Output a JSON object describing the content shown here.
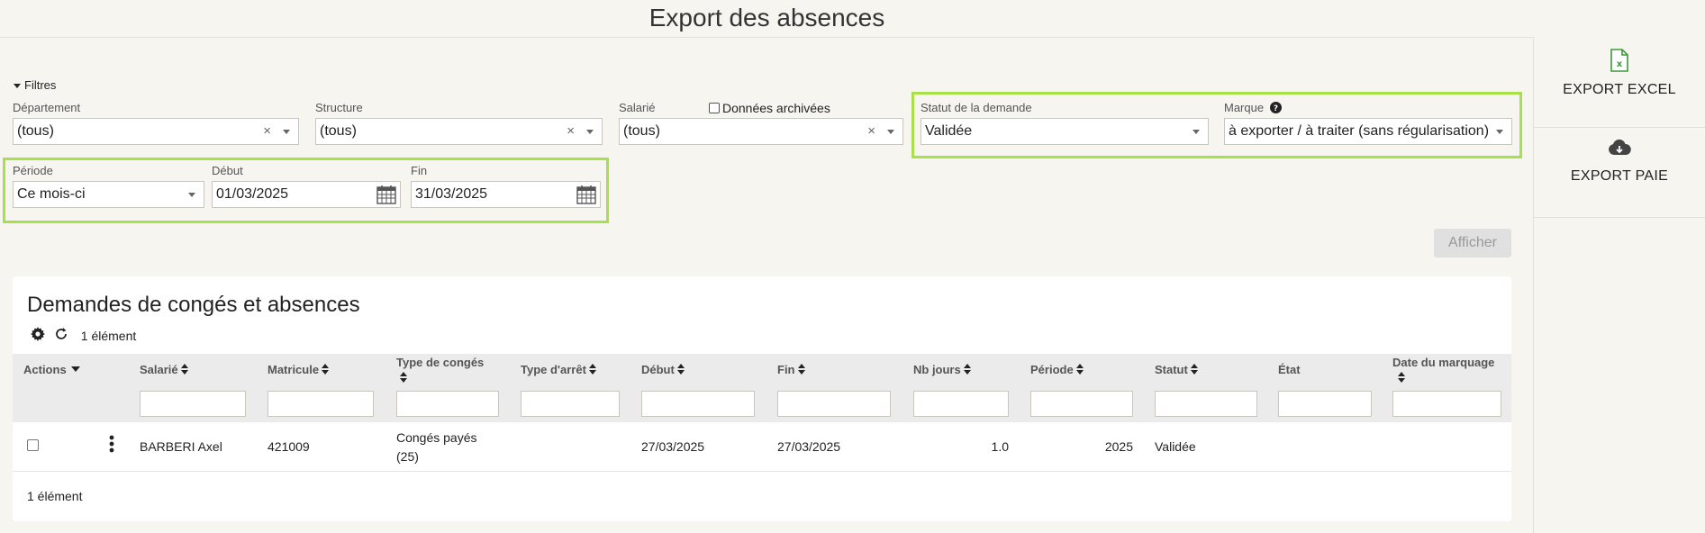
{
  "page": {
    "title": "Export des absences"
  },
  "exports": [
    {
      "label": "EXPORT EXCEL",
      "icon": "excel-file-icon"
    },
    {
      "label": "EXPORT PAIE",
      "icon": "cloud-download-icon"
    }
  ],
  "filters": {
    "toggle_label": "Filtres",
    "departement": {
      "label": "Département",
      "value": "(tous)"
    },
    "structure": {
      "label": "Structure",
      "value": "(tous)"
    },
    "salarie": {
      "label": "Salarié",
      "value": "(tous)"
    },
    "archived": {
      "label": "Données archivées"
    },
    "statut": {
      "label": "Statut de la demande",
      "value": "Validée"
    },
    "marque": {
      "label": "Marque",
      "value": "à exporter / à traiter (sans régularisation)"
    },
    "periode": {
      "label": "Période",
      "value": "Ce mois-ci"
    },
    "debut": {
      "label": "Début",
      "value": "01/03/2025"
    },
    "fin": {
      "label": "Fin",
      "value": "31/03/2025"
    },
    "afficher_label": "Afficher"
  },
  "table": {
    "title": "Demandes de congés et absences",
    "count_label": "1 élément",
    "columns": {
      "actions": "Actions",
      "salarie": "Salarié",
      "matricule": "Matricule",
      "type_conges": "Type de congés",
      "type_arret": "Type d'arrêt",
      "debut": "Début",
      "fin": "Fin",
      "nb_jours": "Nb jours",
      "periode": "Période",
      "statut": "Statut",
      "etat": "État",
      "date_marquage": "Date du marquage"
    },
    "rows": [
      {
        "salarie": "BARBERI Axel",
        "matricule": "421009",
        "type_conges_1": "Congés payés",
        "type_conges_2": "(25)",
        "type_arret": "",
        "debut": "27/03/2025",
        "fin": "27/03/2025",
        "nb_jours": "1.0",
        "periode": "2025",
        "statut": "Validée",
        "etat": "",
        "date_marquage": ""
      }
    ],
    "footer_count": "1 élément"
  }
}
